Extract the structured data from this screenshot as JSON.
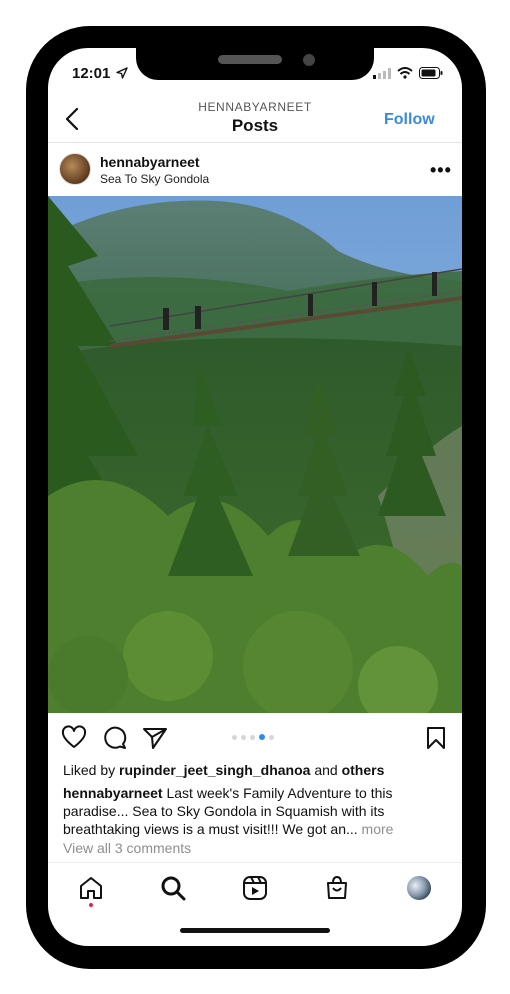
{
  "status_bar": {
    "time": "12:01",
    "icons": [
      "location-arrow-icon",
      "cellular-signal-icon",
      "wifi-icon",
      "battery-icon"
    ]
  },
  "header": {
    "account": "HENNABYARNEET",
    "title": "Posts",
    "follow_label": "Follow"
  },
  "post": {
    "username": "hennabyarneet",
    "location": "Sea To Sky Gondola",
    "carousel": {
      "count": 5,
      "active_index": 3
    },
    "liked_by_prefix": "Liked by",
    "liked_by_user": "rupinder_jeet_singh_dhanoa",
    "liked_by_and": "and",
    "liked_by_others": "others",
    "caption_user": "hennabyarneet",
    "caption_text": "Last week's Family Adventure to this paradise... Sea to Sky Gondola in Squamish with its breathtaking views is a must visit!!! We got an...",
    "more_label": "more",
    "comments_label": "View all 3 comments"
  },
  "nav": {
    "items": [
      "home-icon",
      "search-icon",
      "reels-icon",
      "shop-icon",
      "profile-avatar"
    ],
    "accent": "#3a8bd8",
    "notification_color": "#e0244a"
  }
}
